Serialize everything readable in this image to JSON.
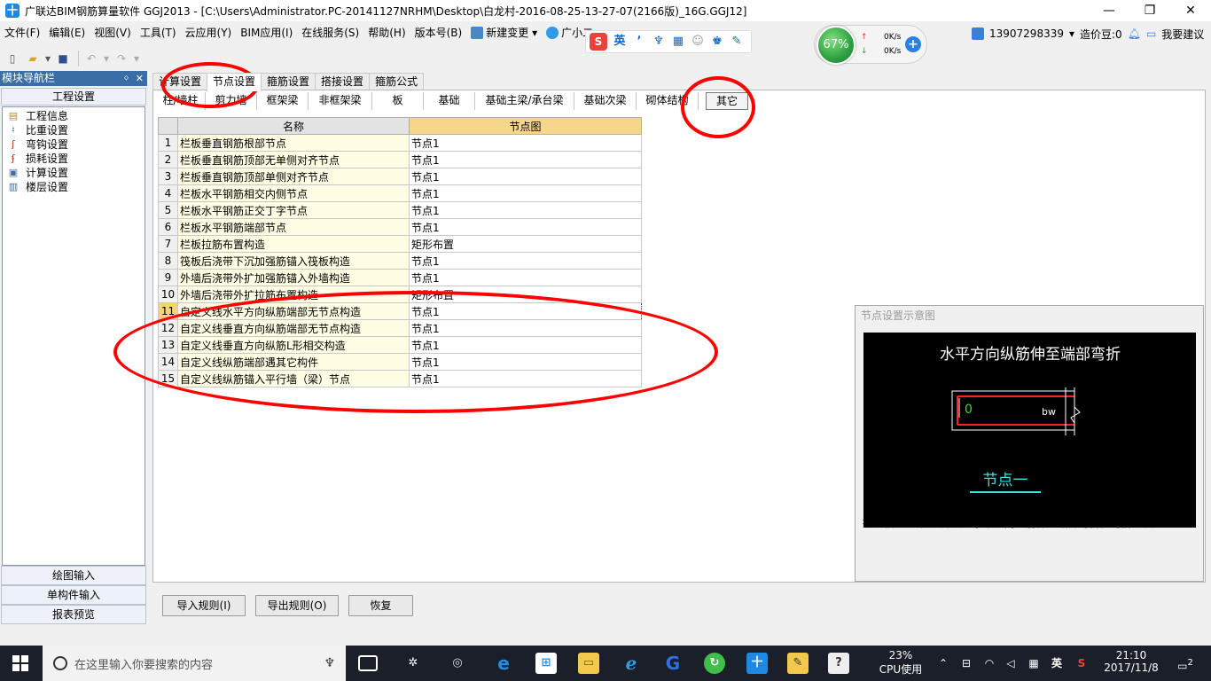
{
  "window": {
    "title": "广联达BIM钢筋算量软件 GGJ2013 - [C:\\Users\\Administrator.PC-20141127NRHM\\Desktop\\白龙村-2016-08-25-13-27-07(2166版)_16G.GGJ12]",
    "app_icon_glyph": "十",
    "minimize": "—",
    "maximize": "❐",
    "close": "✕"
  },
  "menu": {
    "items": [
      "文件(F)",
      "编辑(E)",
      "视图(V)",
      "工具(T)",
      "云应用(Y)",
      "BIM应用(I)",
      "在线服务(S)",
      "帮助(H)",
      "版本号(B)",
      "新建变更",
      "广小二"
    ]
  },
  "ime": {
    "logo": "S",
    "lang": "英",
    "icons": [
      "punctuation-icon",
      "voice-icon",
      "keyboard-icon",
      "user-icon",
      "skin-icon",
      "tools-icon"
    ]
  },
  "network": {
    "percent": "67%",
    "upload": "0K/s",
    "download": "0K/s",
    "plus": "+"
  },
  "header_right": {
    "phone": "13907298339",
    "points": "造价豆:0",
    "feedback": "我要建议"
  },
  "nav": {
    "title": "模块导航栏",
    "pin": "ᛜ",
    "close": "✕",
    "section": "工程设置",
    "items": [
      {
        "label": "工程信息",
        "icon": "info-icon"
      },
      {
        "label": "比重设置",
        "icon": "weight-icon"
      },
      {
        "label": "弯钩设置",
        "icon": "hook-icon"
      },
      {
        "label": "损耗设置",
        "icon": "loss-icon"
      },
      {
        "label": "计算设置",
        "icon": "calc-settings-icon"
      },
      {
        "label": "楼层设置",
        "icon": "floor-icon"
      }
    ],
    "bottom": [
      "绘图输入",
      "单构件输入",
      "报表预览"
    ]
  },
  "main_tabs": [
    "计算设置",
    "节点设置",
    "箍筋设置",
    "搭接设置",
    "箍筋公式"
  ],
  "active_main_tab": 1,
  "sub_tabs": [
    "柱/墙柱",
    "剪力墙",
    "框架梁",
    "非框架梁",
    "板",
    "基础",
    "基础主梁/承台梁",
    "基础次梁",
    "砌体结构",
    "其它"
  ],
  "active_sub_tab": 9,
  "grid": {
    "headers": [
      "",
      "名称",
      "节点图"
    ],
    "rows": [
      {
        "no": "1",
        "name": "栏板垂直钢筋根部节点",
        "value": "节点1"
      },
      {
        "no": "2",
        "name": "栏板垂直钢筋顶部无单侧对齐节点",
        "value": "节点1"
      },
      {
        "no": "3",
        "name": "栏板垂直钢筋顶部单侧对齐节点",
        "value": "节点1"
      },
      {
        "no": "4",
        "name": "栏板水平钢筋相交内侧节点",
        "value": "节点1"
      },
      {
        "no": "5",
        "name": "栏板水平钢筋正交丁字节点",
        "value": "节点1"
      },
      {
        "no": "6",
        "name": "栏板水平钢筋端部节点",
        "value": "节点1"
      },
      {
        "no": "7",
        "name": "栏板拉筋布置构造",
        "value": "矩形布置"
      },
      {
        "no": "8",
        "name": "筏板后浇带下沉加强筋锚入筏板构造",
        "value": "节点1"
      },
      {
        "no": "9",
        "name": "外墙后浇带外扩加强筋锚入外墙构造",
        "value": "节点1"
      },
      {
        "no": "10",
        "name": "外墙后浇带外扩拉筋布置构造",
        "value": "矩形布置"
      },
      {
        "no": "11",
        "name": "自定义线水平方向纵筋端部无节点构造",
        "value": "节点1"
      },
      {
        "no": "12",
        "name": "自定义线垂直方向纵筋端部无节点构造",
        "value": "节点1"
      },
      {
        "no": "13",
        "name": "自定义线垂直方向纵筋L形相交构造",
        "value": "节点1"
      },
      {
        "no": "14",
        "name": "自定义线纵筋端部遇其它构件",
        "value": "节点1"
      },
      {
        "no": "15",
        "name": "自定义线纵筋锚入平行墙（梁）节点",
        "value": "节点1"
      }
    ],
    "selected_row": 10
  },
  "preview": {
    "title": "节点设置示意图",
    "diagram_title": "水平方向纵筋伸至端部弯折",
    "label_zero": "0",
    "label_bw": "bw",
    "node_label": "节点一",
    "hint": "提示信息：  传统算法：水平方向纵筋伸至端部弯折，弯折长度为0。"
  },
  "buttons": {
    "import": "导入规则(I)",
    "export": "导出规则(O)",
    "restore": "恢复"
  },
  "taskbar": {
    "search_placeholder": "在这里输入你要搜索的内容",
    "cpu_percent": "23%",
    "cpu_label": "CPU使用",
    "lang": "英",
    "time": "21:10",
    "date": "2017/11/8",
    "notifications": "2"
  },
  "colors": {
    "annotation": "#ff0000",
    "nav_header": "#3a6ea5",
    "node_header": "#f6d68a",
    "name_cell": "#fffde3",
    "taskbar": "#1b1f2a"
  }
}
